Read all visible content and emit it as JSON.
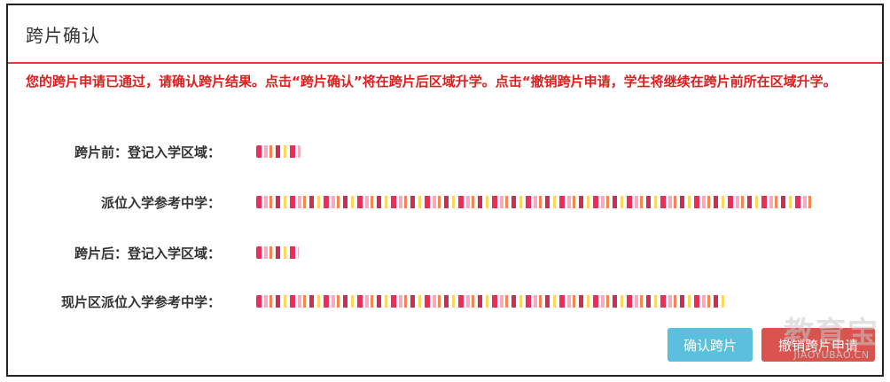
{
  "dialog": {
    "title": "跨片确认",
    "notice": "您的跨片申请已通过，请确认跨片结果。点击“跨片确认”将在跨片后区域升学。点击“撤销跨片申请，学生将继续在跨片前所在区域升学。",
    "fields": [
      {
        "label": "跨片前：登记入学区域："
      },
      {
        "label": "派位入学参考中学："
      },
      {
        "label": "跨片后：登记入学区域："
      },
      {
        "label": "现片区派位入学参考中学："
      }
    ],
    "buttons": {
      "confirm_label": "确认跨片",
      "cancel_label": "撤销跨片申请"
    }
  },
  "watermark": {
    "big": "教育宝",
    "small": "JIAOYUBAO.CN"
  },
  "colors": {
    "accent_red": "#e01e1e",
    "divider_red": "#e53935",
    "confirm_bg": "#5bc0de",
    "cancel_bg": "#d9534f"
  }
}
